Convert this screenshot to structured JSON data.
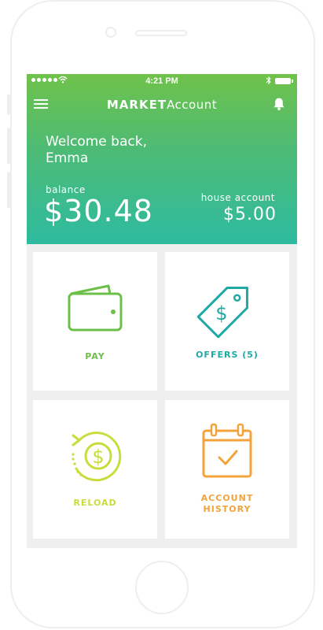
{
  "status_bar": {
    "time": "4:21 PM"
  },
  "app": {
    "title_brand": "MARKET",
    "title_rest": "Account"
  },
  "welcome": {
    "line1": "Welcome back,",
    "line2": "Emma"
  },
  "balance": {
    "label": "balance",
    "value": "$30.48"
  },
  "house_account": {
    "label": "house account",
    "value": "$5.00"
  },
  "tiles": [
    {
      "label": "PAY",
      "icon": "wallet-icon",
      "color": "#6cc04a"
    },
    {
      "label": "OFFERS (5)",
      "icon": "price-tag-icon",
      "color": "#1fa9a6"
    },
    {
      "label": "RELOAD",
      "icon": "reload-dollar-icon",
      "color": "#c8dc3c"
    },
    {
      "label_line1": "ACCOUNT",
      "label_line2": "HISTORY",
      "icon": "calendar-check-icon",
      "color": "#f2a33a"
    }
  ],
  "colors": {
    "header_gradient_top": "#6fc24a",
    "header_gradient_bottom": "#2ebba0",
    "screen_background": "#efefef"
  }
}
